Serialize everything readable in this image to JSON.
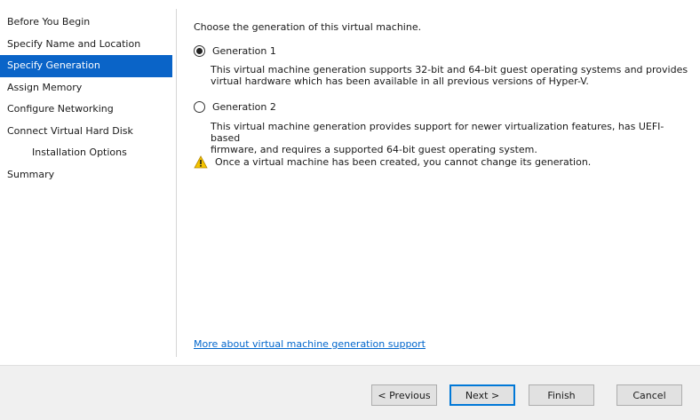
{
  "nav": {
    "items": [
      {
        "label": "Before You Begin"
      },
      {
        "label": "Specify Name and Location"
      },
      {
        "label": "Specify Generation"
      },
      {
        "label": "Assign Memory"
      },
      {
        "label": "Configure Networking"
      },
      {
        "label": "Connect Virtual Hard Disk"
      },
      {
        "label": "Installation Options"
      },
      {
        "label": "Summary"
      }
    ],
    "active_index": 2
  },
  "main": {
    "intro": "Choose the generation of this virtual machine.",
    "options": [
      {
        "label": "Generation 1",
        "selected": true,
        "desc_line1": "This virtual machine generation supports 32-bit and 64-bit guest operating systems and provides",
        "desc_line2": "virtual hardware which has been available in all previous versions of Hyper-V."
      },
      {
        "label": "Generation 2",
        "selected": false,
        "desc_line1": "This virtual machine generation provides support for newer virtualization features, has UEFI-based",
        "desc_line2": "firmware, and requires a supported 64-bit guest operating system."
      }
    ],
    "warning": "Once a virtual machine has been created, you cannot change its generation.",
    "link": "More about virtual machine generation support"
  },
  "footer": {
    "previous": "< Previous",
    "next": "Next >",
    "finish": "Finish",
    "cancel": "Cancel"
  },
  "colors": {
    "accent": "#0a64c8",
    "link": "#0066cc",
    "warning": "#f5c400"
  },
  "icons": {
    "warning": "warning-icon"
  }
}
